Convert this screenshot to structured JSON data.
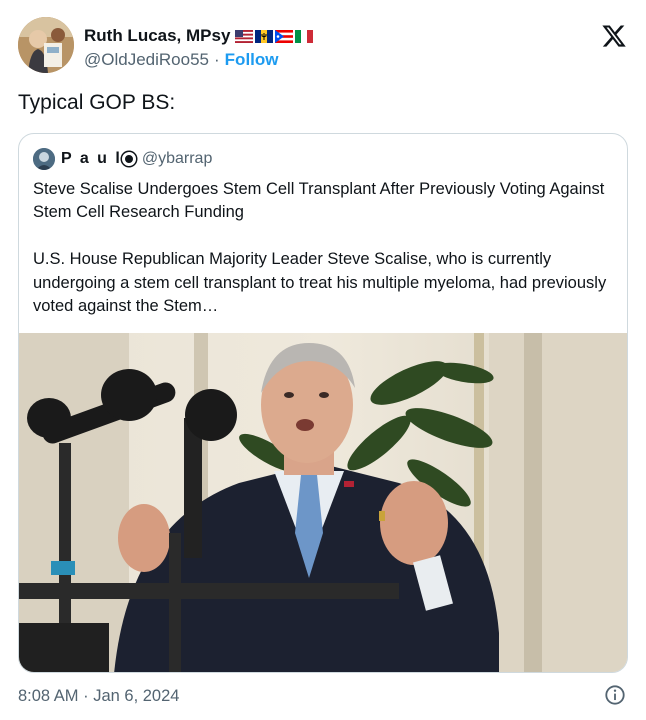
{
  "author": {
    "name": "Ruth Lucas, MPsy",
    "handle": "@OldJediRoo55",
    "separator": "·",
    "follow_label": "Follow",
    "flags": [
      "us-flag",
      "barbados-flag",
      "puerto-rico-flag",
      "italy-flag"
    ]
  },
  "tweet": {
    "text": "Typical GOP BS:",
    "timestamp": "8:08 AM · Jan 6, 2024"
  },
  "quote": {
    "name": "P a u l",
    "handle": "@ybarrap",
    "title": "Steve Scalise Undergoes Stem Cell Transplant After Previously Voting Against Stem Cell Research Funding",
    "body": "U.S. House Republican Majority Leader Steve Scalise, who is currently undergoing a stem cell transplant to treat his multiple myeloma, had previously voted against the Stem…"
  },
  "colors": {
    "accent": "#1d9bf0",
    "text": "#0f1419",
    "secondary": "#536471",
    "border": "#cfd9de"
  },
  "icons": [
    "x-logo-icon",
    "verified-badge-icon",
    "info-icon"
  ]
}
